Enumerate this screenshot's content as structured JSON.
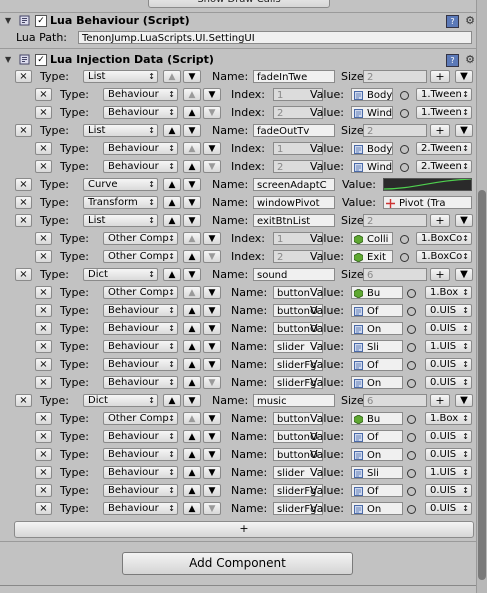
{
  "top_button": "Show Draw Calls",
  "lua_behaviour": {
    "title": "Lua Behaviour (Script)",
    "lua_path_label": "Lua Path:",
    "lua_path_value": "TenonJump.LuaScripts.UI.SettingUI"
  },
  "lua_injection": {
    "title": "Lua Injection Data (Script)"
  },
  "rows": [
    {
      "indent": 0,
      "type": "List",
      "kind": "Name",
      "value": "fadeInTwe",
      "extra": "size",
      "size": "2"
    },
    {
      "indent": 1,
      "type": "Behaviour",
      "kind": "Index",
      "value": "1",
      "obj": "Body",
      "obj_icon": "script",
      "ref": "1.Tween"
    },
    {
      "indent": 1,
      "type": "Behaviour",
      "kind": "Index",
      "value": "2",
      "obj": "Wind",
      "obj_icon": "script",
      "ref": "1.Tween"
    },
    {
      "indent": 0,
      "type": "List",
      "kind": "Name",
      "value": "fadeOutTv",
      "extra": "size",
      "size": "2"
    },
    {
      "indent": 1,
      "type": "Behaviour",
      "kind": "Index",
      "value": "1",
      "obj": "Body",
      "obj_icon": "script",
      "ref": "2.Tween"
    },
    {
      "indent": 1,
      "type": "Behaviour",
      "kind": "Index",
      "value": "2",
      "obj": "Wind",
      "obj_icon": "script",
      "ref": "2.Tween"
    },
    {
      "indent": 0,
      "type": "Curve",
      "kind": "Name",
      "value": "screenAdaptC",
      "extra": "curve"
    },
    {
      "indent": 0,
      "type": "Transform",
      "kind": "Name",
      "value": "windowPivot",
      "extra": "transform",
      "obj": "Pivot (Tra"
    },
    {
      "indent": 0,
      "type": "List",
      "kind": "Name",
      "value": "exitBtnList",
      "extra": "size",
      "size": "2"
    },
    {
      "indent": 1,
      "type": "Other Comp",
      "kind": "Index",
      "value": "1",
      "obj": "Colli",
      "obj_icon": "green",
      "ref": "1.BoxCo"
    },
    {
      "indent": 1,
      "type": "Other Comp",
      "kind": "Index",
      "value": "2",
      "obj": "Exit",
      "obj_icon": "green",
      "ref": "1.BoxCo"
    },
    {
      "indent": 0,
      "type": "Dict",
      "kind": "Name",
      "value": "sound",
      "extra": "size",
      "size": "6"
    },
    {
      "indent": 1,
      "type": "Other Comp",
      "kind": "Name",
      "value": "button",
      "obj": "Bu",
      "obj_icon": "green",
      "ref": "1.Box"
    },
    {
      "indent": 1,
      "type": "Behaviour",
      "kind": "Name",
      "value": "buttonO",
      "obj": "Of",
      "obj_icon": "script",
      "ref": "0.UIS"
    },
    {
      "indent": 1,
      "type": "Behaviour",
      "kind": "Name",
      "value": "buttonO",
      "obj": "On",
      "obj_icon": "script",
      "ref": "0.UIS"
    },
    {
      "indent": 1,
      "type": "Behaviour",
      "kind": "Name",
      "value": "slider",
      "obj": "Sli",
      "obj_icon": "script",
      "ref": "1.UIS"
    },
    {
      "indent": 1,
      "type": "Behaviour",
      "kind": "Name",
      "value": "sliderFg",
      "obj": "Of",
      "obj_icon": "script",
      "ref": "0.UIS"
    },
    {
      "indent": 1,
      "type": "Behaviour",
      "kind": "Name",
      "value": "sliderFg",
      "obj": "On",
      "obj_icon": "script",
      "ref": "0.UIS"
    },
    {
      "indent": 0,
      "type": "Dict",
      "kind": "Name",
      "value": "music",
      "extra": "size",
      "size": "6"
    },
    {
      "indent": 1,
      "type": "Other Comp",
      "kind": "Name",
      "value": "button",
      "obj": "Bu",
      "obj_icon": "green",
      "ref": "1.Box"
    },
    {
      "indent": 1,
      "type": "Behaviour",
      "kind": "Name",
      "value": "buttonO",
      "obj": "Of",
      "obj_icon": "script",
      "ref": "0.UIS"
    },
    {
      "indent": 1,
      "type": "Behaviour",
      "kind": "Name",
      "value": "buttonO",
      "obj": "On",
      "obj_icon": "script",
      "ref": "0.UIS"
    },
    {
      "indent": 1,
      "type": "Behaviour",
      "kind": "Name",
      "value": "slider",
      "obj": "Sli",
      "obj_icon": "script",
      "ref": "1.UIS"
    },
    {
      "indent": 1,
      "type": "Behaviour",
      "kind": "Name",
      "value": "sliderFg",
      "obj": "Of",
      "obj_icon": "script",
      "ref": "0.UIS"
    },
    {
      "indent": 1,
      "type": "Behaviour",
      "kind": "Name",
      "value": "sliderFg",
      "obj": "On",
      "obj_icon": "script",
      "ref": "0.UIS"
    }
  ],
  "labels": {
    "type": "Type:",
    "name": "Name:",
    "index": "Index:",
    "value": "Value:",
    "size": "Size:",
    "remove": "×",
    "add": "+",
    "up": "▲",
    "down": "▼"
  },
  "add_entry": "+",
  "add_component": "Add Component"
}
